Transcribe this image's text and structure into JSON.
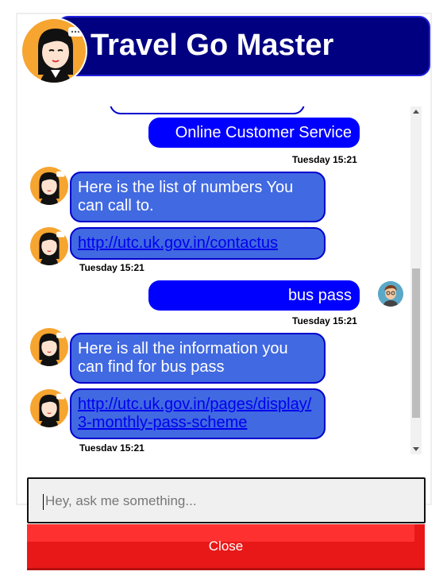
{
  "app": {
    "title": "Travel Go Master"
  },
  "messages": [
    {
      "from": "user",
      "text": "Online Customer Service",
      "time": "Tuesday 15:21"
    },
    {
      "from": "bot",
      "text": "Here is the list of numbers You can call to."
    },
    {
      "from": "bot",
      "link": "http://utc.uk.gov.in/contactus",
      "time": "Tuesday 15:21"
    },
    {
      "from": "user",
      "text": "bus pass",
      "time": "Tuesday 15:21"
    },
    {
      "from": "bot",
      "text": "Here is all the information you can find for bus pass"
    },
    {
      "from": "bot",
      "link": "http://utc.uk.gov.in/pages/display/3-monthly-pass-scheme",
      "time": "Tuesday 15:21"
    }
  ],
  "input": {
    "placeholder": "Hey, ask me something...",
    "value": ""
  },
  "close_label": "Close",
  "colors": {
    "header": "#000080",
    "bot_bubble": "#4169e1",
    "user_bubble": "#0000ff",
    "close_button": "#e81818",
    "avatar_bg": "#f6a531"
  },
  "icons": {
    "bot_avatar": "agent-avatar-icon",
    "user_avatar": "user-avatar-icon"
  }
}
